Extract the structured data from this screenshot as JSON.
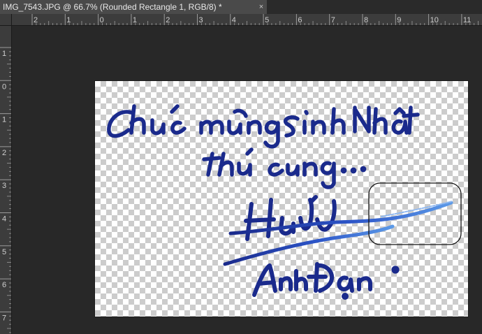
{
  "document_tab": {
    "title": "IMG_7543.JPG @ 66.7% (Rounded Rectangle 1, RGB/8) *",
    "close_glyph": "×"
  },
  "ruler_top_labels": [
    "2",
    "1",
    "0",
    "1",
    "2",
    "3",
    "4",
    "5",
    "6",
    "7",
    "8",
    "9",
    "10",
    "11"
  ],
  "ruler_left_labels": [
    "1",
    "0",
    "1",
    "2",
    "3",
    "4",
    "5",
    "6",
    "7"
  ],
  "colors": {
    "ink_dark": "#1a2a8c",
    "ink_light": "#4f8de6",
    "shape_stroke": "#111111"
  },
  "icons": [
    "close-icon"
  ]
}
